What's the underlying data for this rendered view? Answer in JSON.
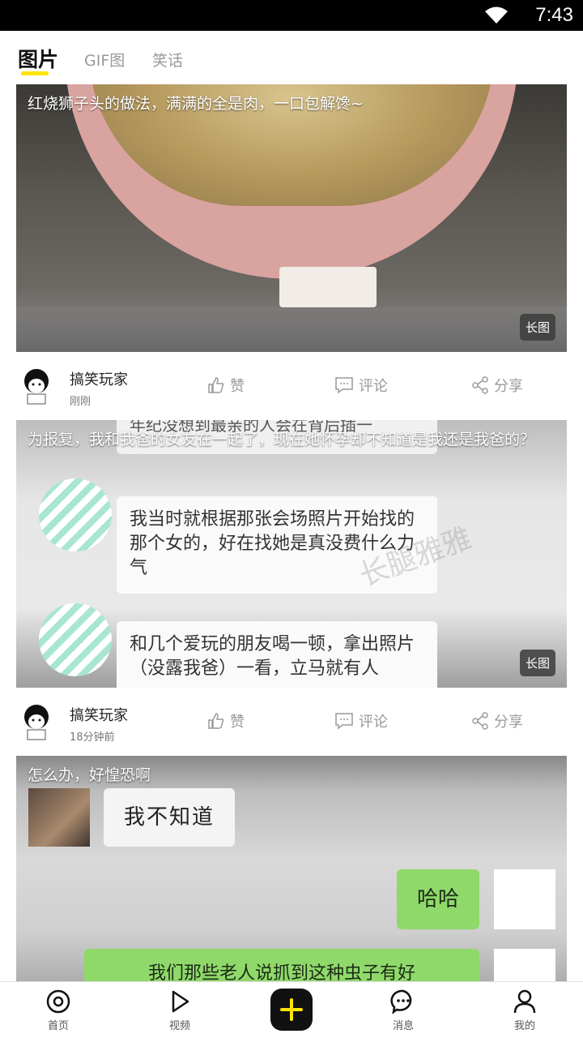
{
  "status_bar": {
    "time": "7:43",
    "wifi_icon": "wifi-icon"
  },
  "tabs": [
    {
      "label": "图片",
      "active": true
    },
    {
      "label": "GIF图",
      "active": false
    },
    {
      "label": "笑话",
      "active": false
    }
  ],
  "posts": [
    {
      "title": "红烧狮子头的做法，满满的全是肉，一口包解馋~",
      "badge": "长图",
      "author": "搞笑玩家",
      "time": "刚刚",
      "like_label": "赞",
      "comment_label": "评论",
      "share_label": "分享"
    },
    {
      "title": "为报复，我和我爸的女友在一起了，现在她怀孕却不知道是我还是我爸的？",
      "badge": "长图",
      "author": "搞笑玩家",
      "time": "18分钟前",
      "like_label": "赞",
      "comment_label": "评论",
      "share_label": "分享",
      "image_texts": {
        "top_fragment": "年纪没想到最亲的人会在背后插一",
        "bubble_1": "我当时就根据那张会场照片开始找的那个女的，好在找她是真没费什么力气",
        "bubble_2": "和几个爱玩的朋友喝一顿，拿出照片（没露我爸）一看，立马就有人",
        "watermark": "长腿雅雅"
      }
    },
    {
      "title": "怎么办，好惶恐啊",
      "image_texts": {
        "bubble_left": "我不知道",
        "bubble_right": "哈哈",
        "bubble_bottom": "我们那些老人说抓到这种虫子有好"
      }
    }
  ],
  "bottom_nav": [
    {
      "label": "首页",
      "icon": "home-icon"
    },
    {
      "label": "视频",
      "icon": "play-icon"
    },
    {
      "label": "",
      "icon": "plus-icon"
    },
    {
      "label": "消息",
      "icon": "message-icon"
    },
    {
      "label": "我的",
      "icon": "profile-icon"
    }
  ],
  "colors": {
    "accent": "#ffe400",
    "post_button": "#111111"
  }
}
